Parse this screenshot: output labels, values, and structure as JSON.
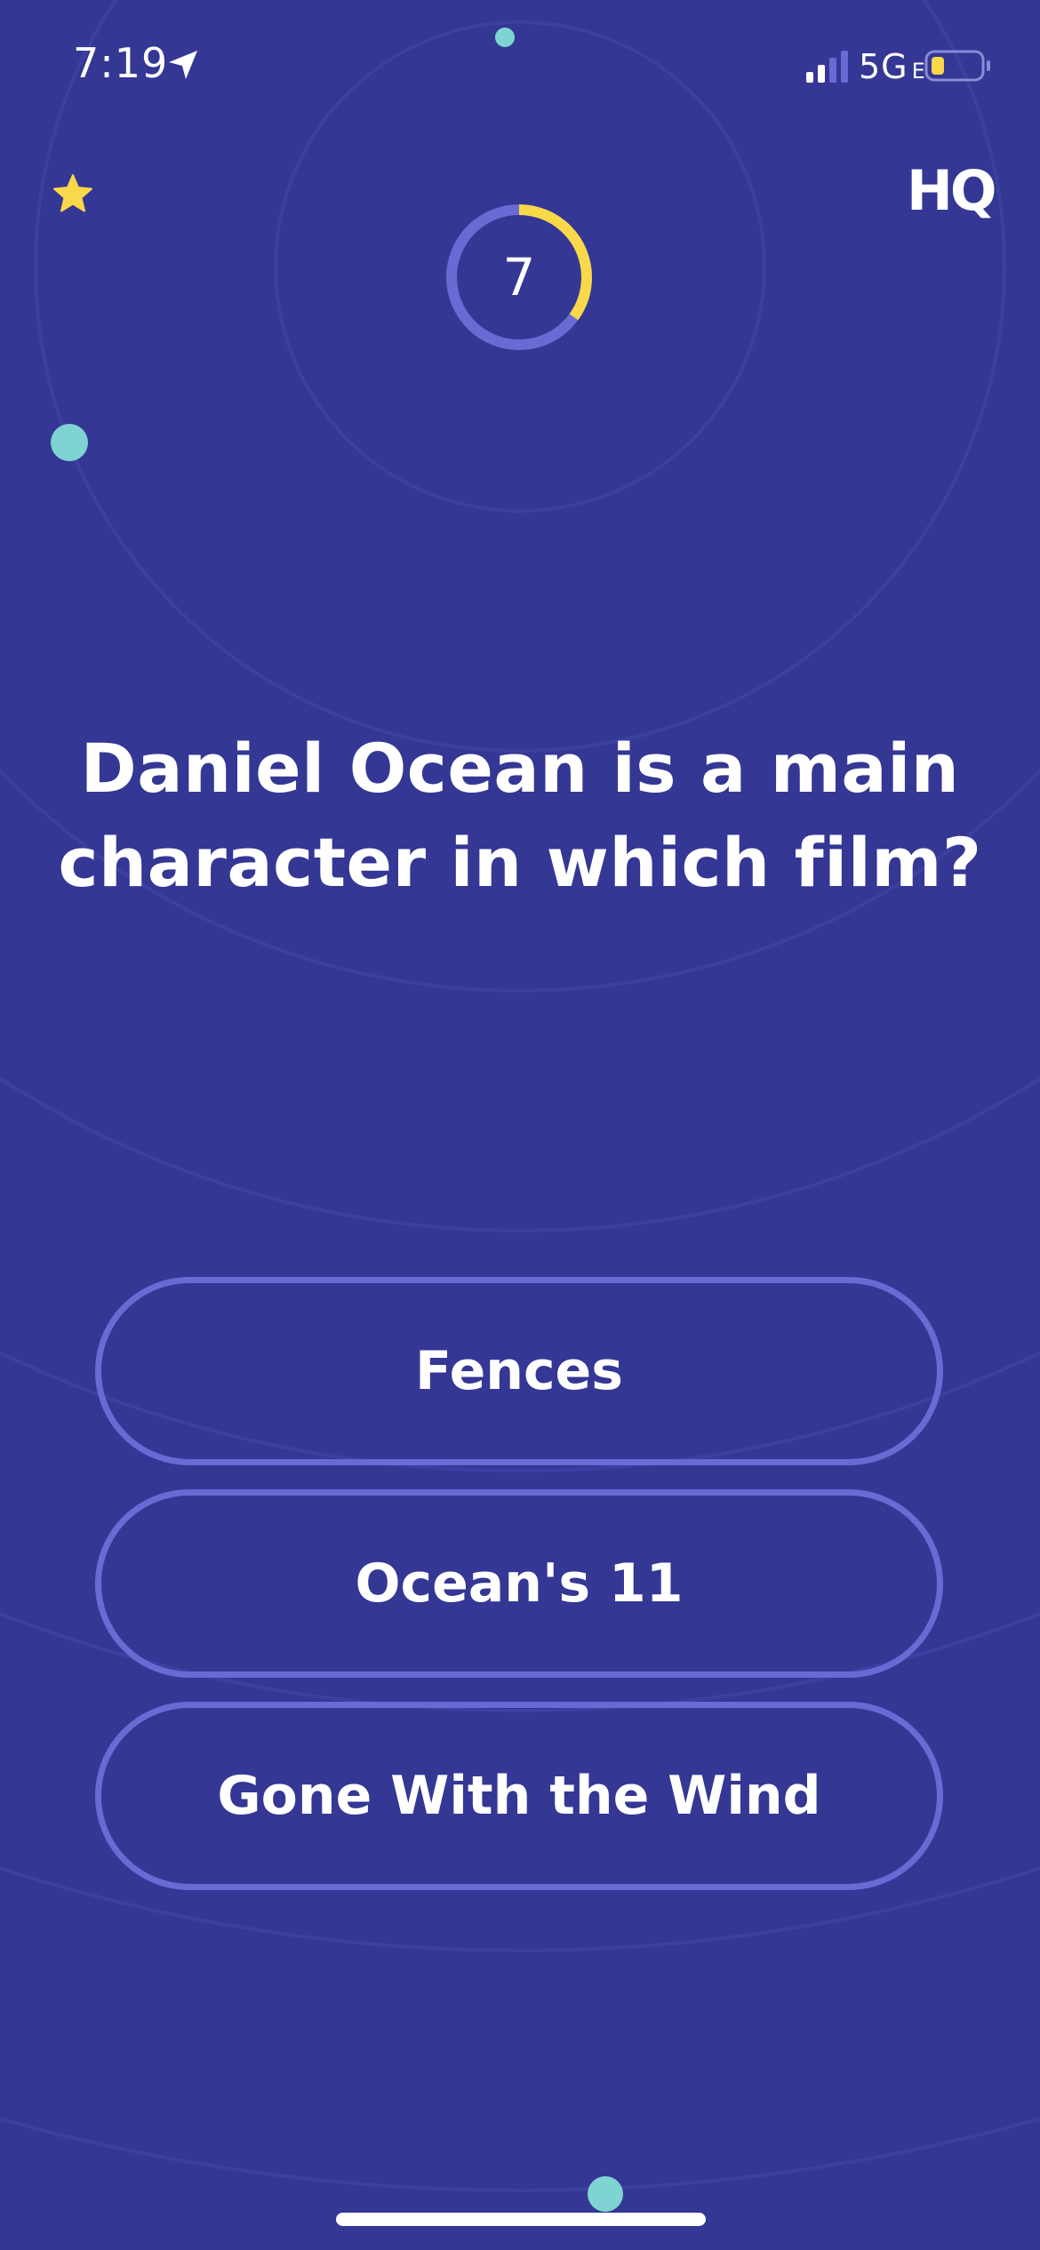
{
  "status_bar": {
    "time": "7:19",
    "network": "5G",
    "network_suffix": "E",
    "location_icon": "location-arrow-icon",
    "signal_icon": "cellular-signal-icon",
    "battery_icon": "battery-low-icon",
    "battery_level": 0.2
  },
  "header": {
    "star_icon": "star-icon",
    "logo_text": "HQ"
  },
  "timer": {
    "value": "7",
    "remaining_fraction": 0.35
  },
  "question": {
    "text": "Daniel Ocean is a main character in which film?"
  },
  "answers": [
    {
      "label": "Fences"
    },
    {
      "label": "Ocean's 11"
    },
    {
      "label": "Gone With the Wind"
    }
  ],
  "colors": {
    "background": "#343794",
    "ring": "#6a6ad4",
    "accent_yellow": "#f9d849",
    "dot_teal": "#7fd3d2"
  }
}
